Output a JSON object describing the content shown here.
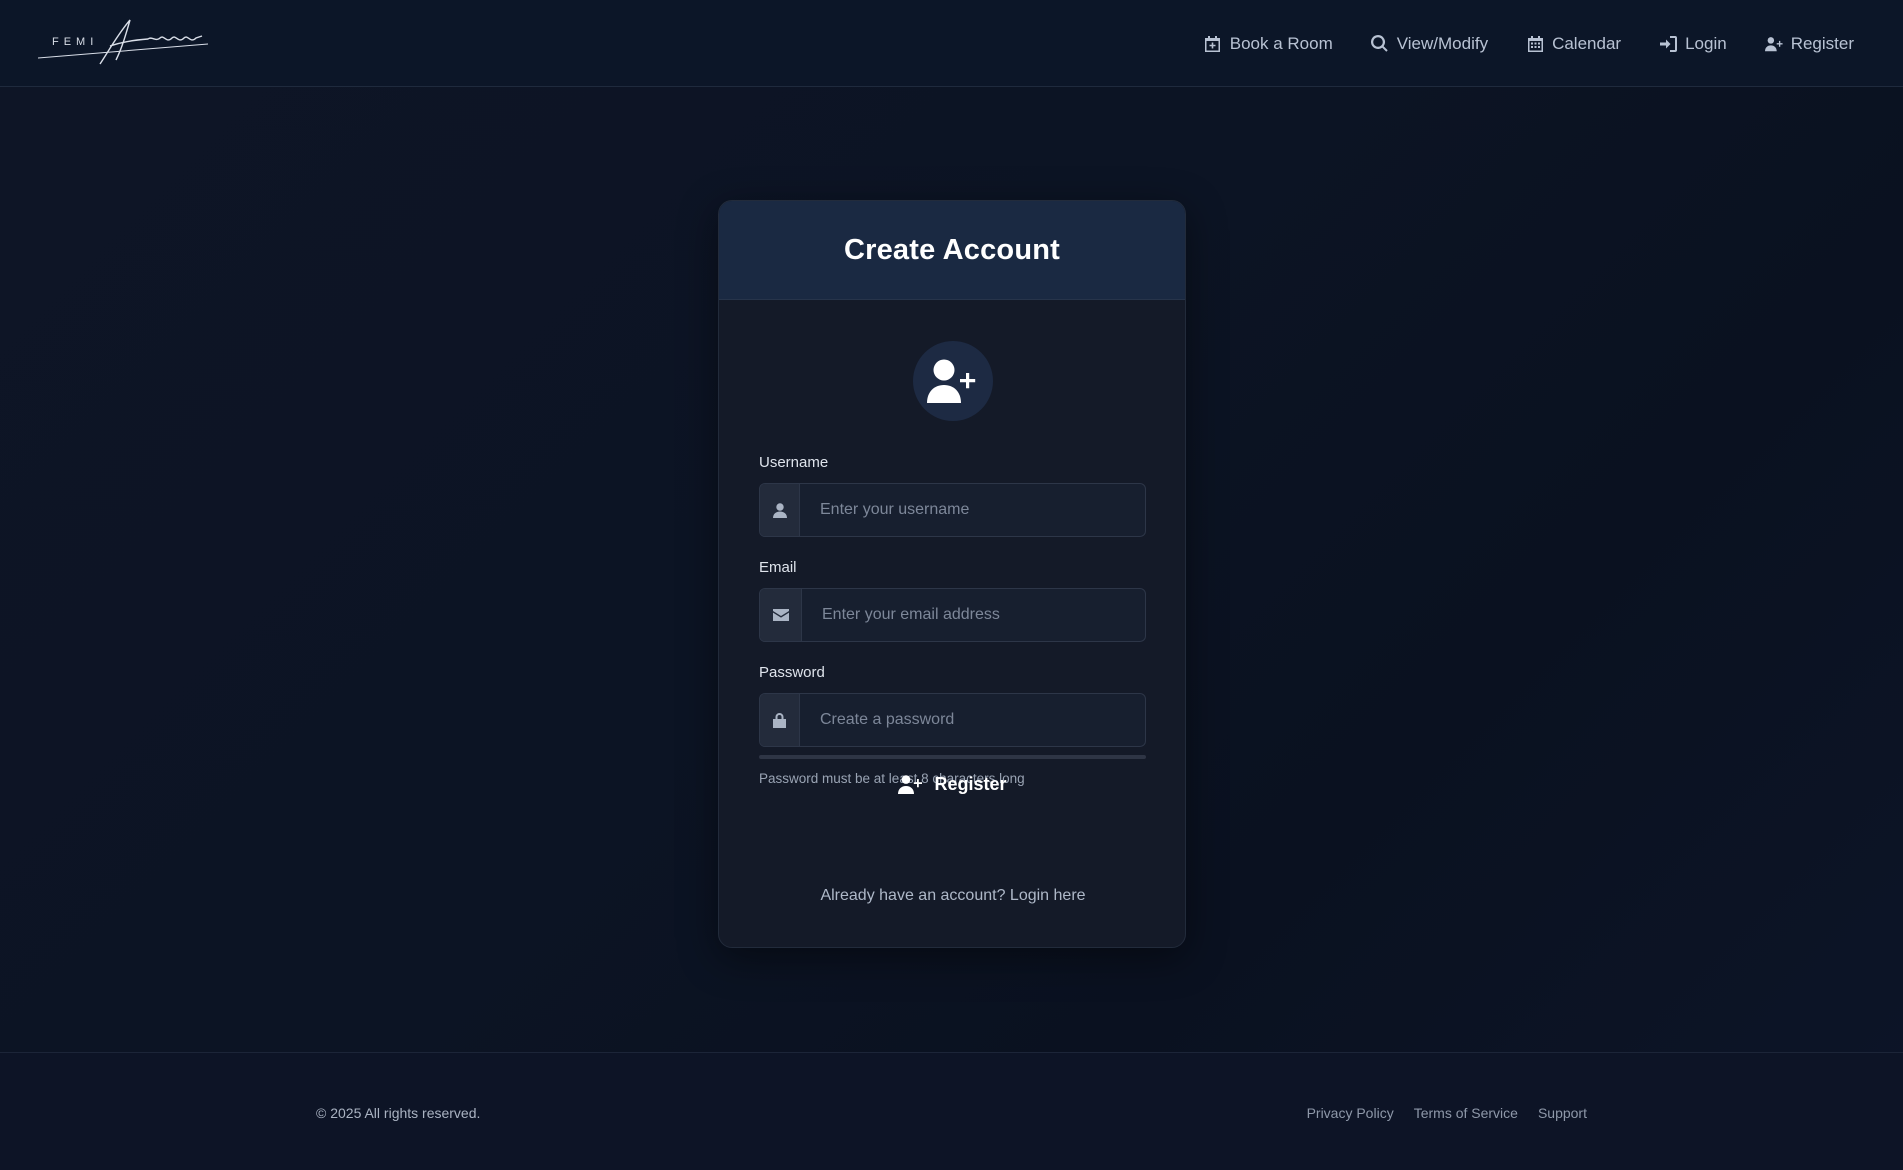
{
  "header": {
    "logo_text": "FEMI",
    "logo_script": "Akinlosotu",
    "nav": [
      {
        "label": "Book a Room",
        "icon": "calendar-plus-icon"
      },
      {
        "label": "View/Modify",
        "icon": "search-icon"
      },
      {
        "label": "Calendar",
        "icon": "calendar-icon"
      },
      {
        "label": "Login",
        "icon": "sign-in-icon"
      },
      {
        "label": "Register",
        "icon": "user-plus-icon"
      }
    ]
  },
  "card": {
    "title": "Create Account",
    "avatar_icon": "user-plus-icon",
    "fields": {
      "username": {
        "label": "Username",
        "placeholder": "Enter your username",
        "icon": "user-icon"
      },
      "email": {
        "label": "Email",
        "placeholder": "Enter your email address",
        "icon": "envelope-icon"
      },
      "password": {
        "label": "Password",
        "placeholder": "Create a password",
        "icon": "lock-icon",
        "hint": "Password must be at least 8 characters long"
      }
    },
    "submit_label": "Register",
    "login_prompt": "Already have an account?",
    "login_link": "Login here"
  },
  "footer": {
    "copyright": "© 2025 All rights reserved.",
    "links": [
      "Privacy Policy",
      "Terms of Service",
      "Support"
    ]
  },
  "colors": {
    "background": "#0c1424",
    "card": "#141a28",
    "card_header": "#1a2942",
    "text": "#e6e9ef"
  }
}
